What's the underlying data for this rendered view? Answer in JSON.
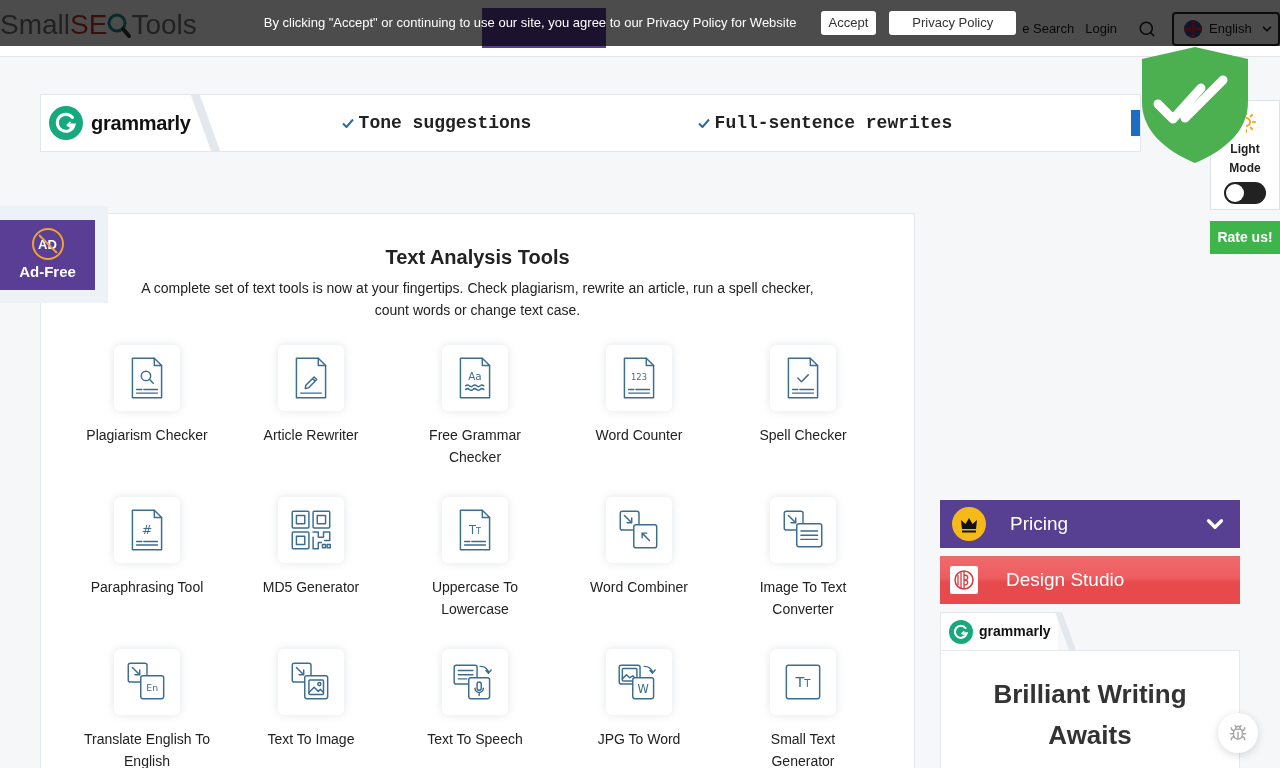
{
  "navbar": {
    "logo": {
      "prefix": "Small",
      "highlight": "SE",
      "suffix": "Tools"
    },
    "links": [
      {
        "label": "e Search"
      },
      {
        "label": "Login"
      }
    ],
    "language": "English"
  },
  "cookie_banner": {
    "message": "By clicking \"Accept\" or continuing to use our site, you agree to our Privacy Policy for Website",
    "buttons": [
      {
        "label": "Accept"
      },
      {
        "label": "Privacy Policy"
      }
    ]
  },
  "grammarly_banner": {
    "brand": "grammarly",
    "features": [
      "Tone suggestions",
      "Full-sentence rewrites"
    ]
  },
  "theme_toggle": {
    "label": "Light Mode",
    "on": false
  },
  "rate_button": {
    "label": "Rate us!"
  },
  "ad_free": {
    "icon_text": "AD",
    "label": "Ad-Free"
  },
  "tools_panel": {
    "title": "Text Analysis Tools",
    "description": "A complete set of text tools is now at your fingertips. Check plagiarism, rewrite an article, run a spell checker, count words or change text case.",
    "tools": [
      {
        "label": "Plagiarism Checker",
        "kind": "search"
      },
      {
        "label": "Article Rewriter",
        "kind": "pencil"
      },
      {
        "label": "Free Grammar Checker",
        "kind": "letters",
        "glyph": "Aa"
      },
      {
        "label": "Word Counter",
        "kind": "numbers",
        "glyph": "123"
      },
      {
        "label": "Spell Checker",
        "kind": "check"
      },
      {
        "label": "Paraphrasing Tool",
        "kind": "hash",
        "glyph": "#"
      },
      {
        "label": "MD5 Generator",
        "kind": "qrcode"
      },
      {
        "label": "Uppercase To Lowercase",
        "kind": "case",
        "glyph": "TT"
      },
      {
        "label": "Word Combiner",
        "kind": "combine"
      },
      {
        "label": "Image To Text Converter",
        "kind": "ocr"
      },
      {
        "label": "Translate English To English",
        "kind": "translate",
        "glyph": "En"
      },
      {
        "label": "Text To Image",
        "kind": "picture"
      },
      {
        "label": "Text To Speech",
        "kind": "speech"
      },
      {
        "label": "JPG To Word",
        "kind": "convert",
        "glyph": "W"
      },
      {
        "label": "Small Text Generator",
        "kind": "smalltext",
        "glyph": "TT"
      }
    ]
  },
  "sidebar": {
    "pricing": {
      "label": "Pricing",
      "expanded": false
    },
    "design_studio": {
      "label": "Design Studio"
    },
    "grammarly_ad": {
      "brand": "grammarly",
      "headline": "Brilliant Writing Awaits"
    }
  }
}
